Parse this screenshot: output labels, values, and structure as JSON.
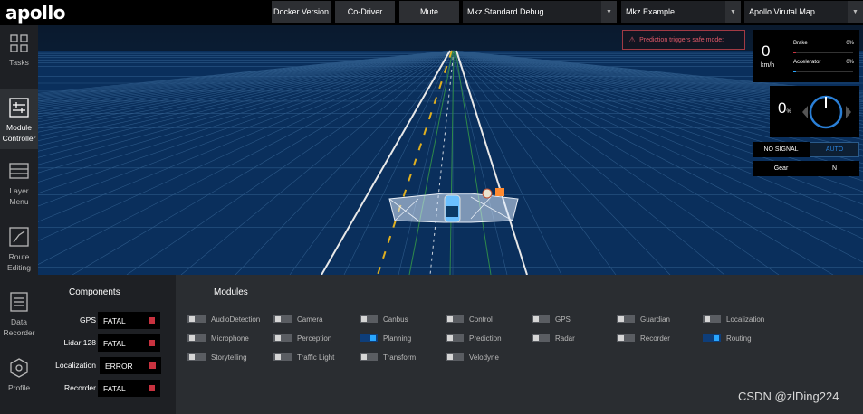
{
  "app": {
    "logo": "apollo"
  },
  "topbar": {
    "docker_version": "Docker Version",
    "co_driver": "Co-Driver",
    "mute": "Mute",
    "mode_select": "Mkz Standard Debug",
    "vehicle_select": "Mkz Example",
    "map_select": "Apollo Virutal Map"
  },
  "sidebar": {
    "items": [
      {
        "label": "Tasks",
        "icon": "grid-icon"
      },
      {
        "label": "Module Controller",
        "icon": "sliders-icon",
        "active": true
      },
      {
        "label": "Layer Menu",
        "icon": "layers-icon"
      },
      {
        "label": "Route Editing",
        "icon": "route-icon"
      },
      {
        "label": "Data Recorder",
        "icon": "document-icon"
      },
      {
        "label": "Profile",
        "icon": "hexagon-icon"
      }
    ]
  },
  "notification": {
    "text": "Prediction triggers safe mode:"
  },
  "dashboard": {
    "speed": "0",
    "speed_unit": "km/h",
    "brake_label": "Brake",
    "brake_pct": "0%",
    "brake_level": 0,
    "accelerator_label": "Accelerator",
    "accelerator_pct": "0%",
    "accelerator_level": 0,
    "steering": "0",
    "steering_unit": "%",
    "signal": "NO SIGNAL",
    "drive_mode": "AUTO",
    "gear_label": "Gear",
    "gear": "N"
  },
  "components": {
    "title": "Components",
    "items": [
      {
        "name": "GPS",
        "status": "FATAL"
      },
      {
        "name": "Lidar 128",
        "status": "FATAL"
      },
      {
        "name": "Localization",
        "status": "ERROR"
      },
      {
        "name": "Recorder",
        "status": "FATAL"
      }
    ]
  },
  "modules": {
    "title": "Modules",
    "items": [
      {
        "name": "AudioDetection",
        "on": false
      },
      {
        "name": "Camera",
        "on": false
      },
      {
        "name": "Canbus",
        "on": false
      },
      {
        "name": "Control",
        "on": false
      },
      {
        "name": "GPS",
        "on": false
      },
      {
        "name": "Guardian",
        "on": false
      },
      {
        "name": "Localization",
        "on": false
      },
      {
        "name": "Microphone",
        "on": false
      },
      {
        "name": "Perception",
        "on": false
      },
      {
        "name": "Planning",
        "on": true
      },
      {
        "name": "Prediction",
        "on": false
      },
      {
        "name": "Radar",
        "on": false
      },
      {
        "name": "Recorder",
        "on": false
      },
      {
        "name": "Routing",
        "on": true
      },
      {
        "name": "Storytelling",
        "on": false
      },
      {
        "name": "Traffic Light",
        "on": false
      },
      {
        "name": "Transform",
        "on": false
      },
      {
        "name": "Velodyne",
        "on": false
      }
    ]
  },
  "colors": {
    "fatal": "#c8323f",
    "toggle_on": "#29a6ff",
    "scene_bg": "#0a2f5c"
  },
  "watermark": "CSDN @zlDing224"
}
